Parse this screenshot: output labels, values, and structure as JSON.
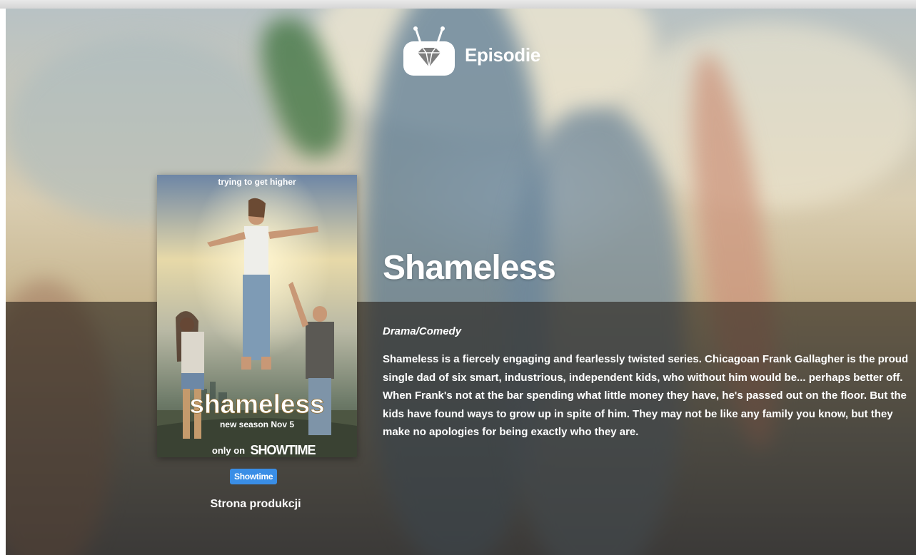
{
  "app": {
    "name": "Episodie"
  },
  "show": {
    "title": "Shameless",
    "genre": "Drama/Comedy",
    "synopsis": "Shameless is a fiercely engaging and fearlessly twisted series. Chicagoan Frank Gallagher is the proud single dad of six smart, industrious, independent kids, who without him would be... perhaps better off. When Frank's not at the bar spending what little money they have, he's passed out on the floor. But the kids have found ways to grow up in spite of him. They may not be like any family you know, but they make no apologies for being exactly who they are.",
    "network": "Showtime",
    "production_link": "Strona produkcji"
  },
  "poster": {
    "tagline": "trying to get higher",
    "title_text": "shameless",
    "season_text": "new season Nov 5",
    "only_on": "only on",
    "network_logo": "SHOWTIME"
  },
  "colors": {
    "badge_blue": "#3a8ee6",
    "text_white": "#ffffff",
    "overlay_dark": "rgba(38,32,26,0.62)"
  },
  "icons": {
    "logo": "tv-diamond-icon"
  }
}
